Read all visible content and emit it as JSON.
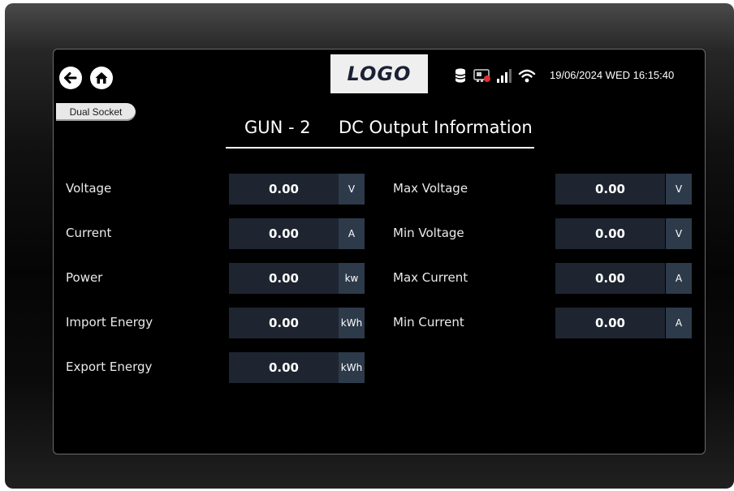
{
  "header": {
    "logo_text": "LOGO",
    "datetime": "19/06/2024 WED 16:15:40",
    "back_icon": "back-arrow-icon",
    "home_icon": "home-icon",
    "status_icons": [
      "database-icon",
      "network-card-icon",
      "signal-icon",
      "wifi-icon"
    ]
  },
  "tag": {
    "label": "Dual Socket"
  },
  "title": {
    "gun": "GUN - 2",
    "section": "DC Output Information"
  },
  "left_fields": [
    {
      "label": "Voltage",
      "value": "0.00",
      "unit": "V"
    },
    {
      "label": "Current",
      "value": "0.00",
      "unit": "A"
    },
    {
      "label": "Power",
      "value": "0.00",
      "unit": "kw"
    },
    {
      "label": "Import Energy",
      "value": "0.00",
      "unit": "kWh"
    },
    {
      "label": "Export Energy",
      "value": "0.00",
      "unit": "kWh"
    }
  ],
  "right_fields": [
    {
      "label": "Max Voltage",
      "value": "0.00",
      "unit": "V"
    },
    {
      "label": "Min Voltage",
      "value": "0.00",
      "unit": "V"
    },
    {
      "label": "Max Current",
      "value": "0.00",
      "unit": "A"
    },
    {
      "label": "Min Current",
      "value": "0.00",
      "unit": "A"
    }
  ],
  "colors": {
    "screen_bg": "#000000",
    "field_bg": "#1e2530",
    "unit_bg": "#2d3a4a",
    "text": "#ffffff"
  }
}
